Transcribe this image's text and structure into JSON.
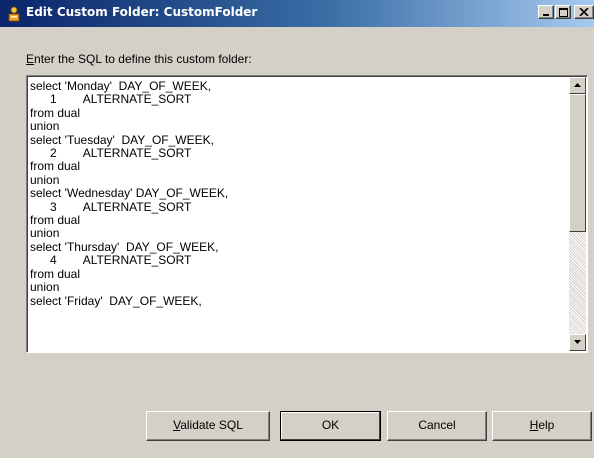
{
  "window": {
    "title": "Edit Custom Folder: CustomFolder",
    "icon": "custom-folder-icon",
    "controls": {
      "minimize_icon": "minimize-icon",
      "maximize_icon": "maximize-icon",
      "close_icon": "close-icon"
    }
  },
  "prompt": {
    "accel": "E",
    "rest": "nter the SQL to define this custom folder:"
  },
  "editor": {
    "sql": "select 'Monday'  DAY_OF_WEEK,\n      1        ALTERNATE_SORT\nfrom dual\nunion\nselect 'Tuesday'  DAY_OF_WEEK,\n      2        ALTERNATE_SORT\nfrom dual\nunion\nselect 'Wednesday' DAY_OF_WEEK,\n      3        ALTERNATE_SORT\nfrom dual\nunion\nselect 'Thursday'  DAY_OF_WEEK,\n      4        ALTERNATE_SORT\nfrom dual\nunion\nselect 'Friday'  DAY_OF_WEEK,"
  },
  "buttons": {
    "validate": {
      "accel": "V",
      "rest": "alidate SQL"
    },
    "ok": {
      "label": "OK"
    },
    "cancel": {
      "label": "Cancel"
    },
    "help": {
      "accel": "H",
      "rest": "elp"
    }
  }
}
